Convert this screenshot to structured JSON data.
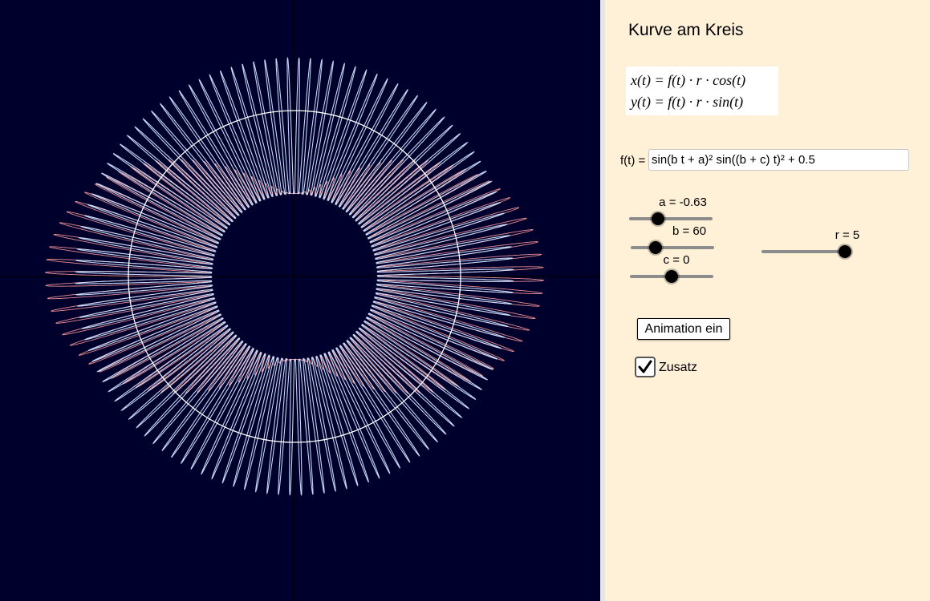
{
  "app": {
    "title": "Kurve am Kreis"
  },
  "formulas": [
    "x(t) = f(t) · r · cos(t)",
    "y(t) = f(t) · r · sin(t)"
  ],
  "function_input": {
    "label": "f(t) =",
    "value": "sin(b t + a)² sin((b + c) t)² + 0.5"
  },
  "sliders": {
    "a": {
      "label": "a = -0.63",
      "value": -0.63,
      "min": -2,
      "max": 2
    },
    "b": {
      "label": "b = 60",
      "value": 60,
      "min": 0,
      "max": 200
    },
    "c": {
      "label": "c = 0",
      "value": 0,
      "min": -2,
      "max": 2
    },
    "r": {
      "label": "r = 5",
      "value": 5,
      "min": 0,
      "max": 5
    }
  },
  "buttons": {
    "animation_label": "Animation ein"
  },
  "checkbox": {
    "label": "Zusatz",
    "checked": true
  },
  "colors": {
    "canvas_bg": "#00002d",
    "panel_bg": "#fff0d8",
    "curve_main": "#cfe3ff",
    "curve_extra": "#ff9a9a",
    "circle": "#ffffff",
    "axes": "#000000"
  }
}
